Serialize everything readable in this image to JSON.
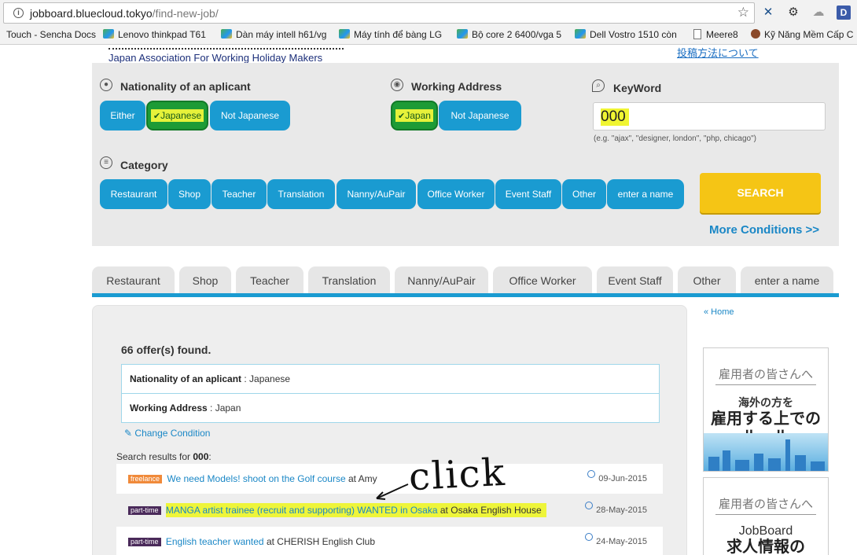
{
  "browser": {
    "url_domain": "jobboard.bluecloud.tokyo",
    "url_path": "/find-new-job/",
    "bookmarks": [
      "Touch - Sencha Docs",
      "Lenovo thinkpad T61",
      "Dàn máy intell h61/vg",
      "Máy tính để bàng LG",
      "Bộ core 2 6400/vga 5",
      "Dell Vostro 1510 còn",
      "Meere8",
      "Kỹ Năng Mềm Cấp C"
    ],
    "ext_d": "D"
  },
  "header": {
    "association": "Japan Association For Working Holiday Makers",
    "top_link": "投稿方法について"
  },
  "search": {
    "nationality": {
      "title": "Nationality of an aplicant",
      "options": [
        "Either",
        "Japanese",
        "Not Japanese"
      ],
      "selected": "Japanese"
    },
    "working_address": {
      "title": "Working Address",
      "options": [
        "Japan",
        "Not Japanese"
      ],
      "selected": "Japan"
    },
    "keyword": {
      "title": "KeyWord",
      "value": "000",
      "hint": "(e.g. \"ajax\", \"designer, london\", \"php, chicago\")"
    },
    "category": {
      "title": "Category",
      "options": [
        "Restaurant",
        "Shop",
        "Teacher",
        "Translation",
        "Nanny/AuPair",
        "Office Worker",
        "Event Staff",
        "Other",
        "enter a name"
      ]
    },
    "search_button": "SEARCH",
    "more_conditions": "More Conditions >>"
  },
  "tabs": [
    "Restaurant",
    "Shop",
    "Teacher",
    "Translation",
    "Nanny/AuPair",
    "Office Worker",
    "Event Staff",
    "Other",
    "enter a name"
  ],
  "results": {
    "count_text": "66 offer(s) found.",
    "conditions": [
      {
        "label": "Nationality of an aplicant",
        "value": " : Japanese"
      },
      {
        "label": "Working Address",
        "value": " : Japan"
      }
    ],
    "change_condition": "Change Condition",
    "search_for_prefix": "Search results for ",
    "search_for_term": "000",
    "search_for_suffix": ":",
    "jobs": [
      {
        "tag": "freelance",
        "title": "We need Models! shoot on the Golf course",
        "at": " at ",
        "company": "Amy",
        "date": "09-Jun-2015"
      },
      {
        "tag": "part-time",
        "title": "MANGA artist trainee (recruit and supporting) WANTED in Osaka",
        "at": " at ",
        "company": "Osaka English House",
        "date": "28-May-2015"
      },
      {
        "tag": "part-time",
        "title": "English teacher wanted",
        "at": " at ",
        "company": "CHERISH English Club",
        "date": "24-May-2015"
      }
    ]
  },
  "sidebar": {
    "home_link": "« Home",
    "banner1": {
      "head": "雇用者の皆さんへ",
      "line1": "海外の方を",
      "line2a": "雇用する上での",
      "line2b": "ルール"
    },
    "banner2": {
      "head": "雇用者の皆さんへ",
      "line1": "JobBoard",
      "line2a": "求人情報の"
    }
  },
  "annotation": {
    "text": "click"
  }
}
